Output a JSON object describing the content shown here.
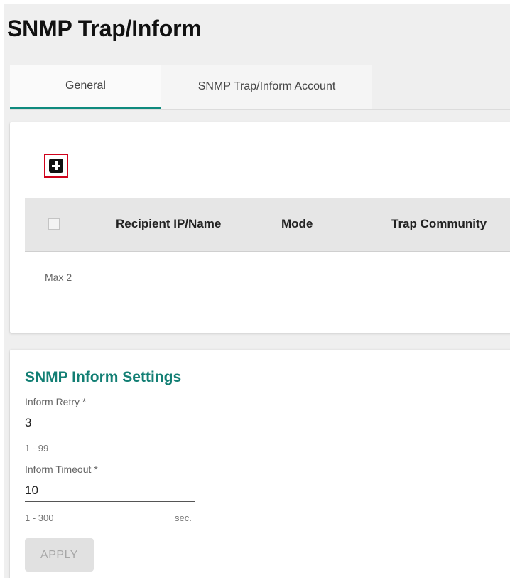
{
  "page": {
    "title": "SNMP Trap/Inform"
  },
  "tabs": [
    {
      "label": "General",
      "active": true
    },
    {
      "label": "SNMP Trap/Inform Account",
      "active": false
    }
  ],
  "table": {
    "add_icon": "plus-square-icon",
    "columns": [
      "Recipient IP/Name",
      "Mode",
      "Trap Community"
    ],
    "rows": [],
    "max_note": "Max 2"
  },
  "inform_settings": {
    "title": "SNMP Inform Settings",
    "retry": {
      "label": "Inform Retry *",
      "value": "3",
      "hint": "1 - 99"
    },
    "timeout": {
      "label": "Inform Timeout *",
      "value": "10",
      "hint": "1 - 300",
      "unit": "sec."
    },
    "apply_label": "APPLY"
  },
  "colors": {
    "accent": "#0e8a7e",
    "section_title": "#137f74",
    "highlight_border": "#d0021b"
  }
}
